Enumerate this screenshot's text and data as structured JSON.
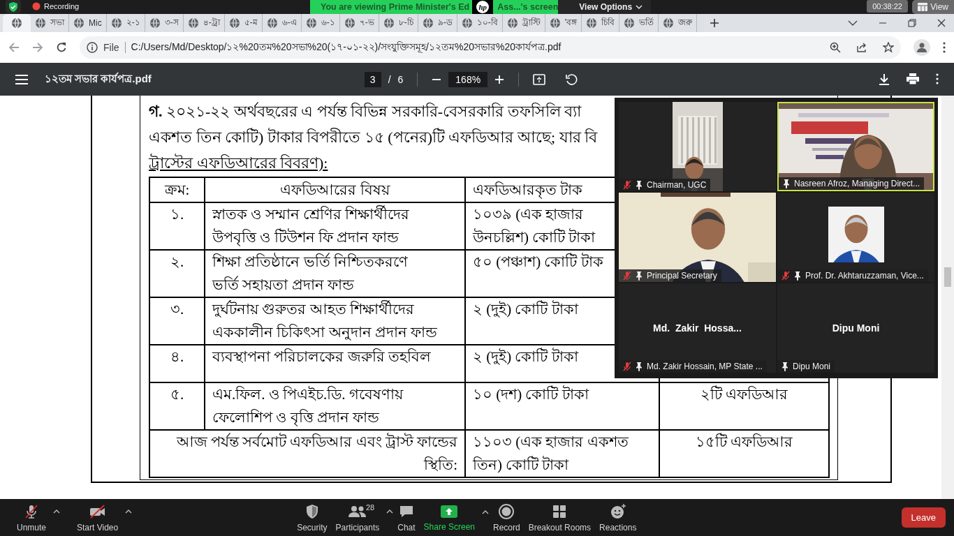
{
  "share_bar": {
    "recording": "Recording",
    "banner_start": "You are viewing Prime Minister's Ed",
    "logo": "hp",
    "banner_end": "Ass...'s screen",
    "view_options": "View Options",
    "timer": "00:38:22",
    "view": "View"
  },
  "browser": {
    "tabs": [
      {
        "selected": true
      },
      {
        "title": "সভা",
        "selected": false
      },
      {
        "title": "Mic",
        "selected": false
      },
      {
        "title": "২-১",
        "selected": false
      },
      {
        "title": "৩-স",
        "selected": false
      },
      {
        "title": "৪-ট্রা",
        "selected": false
      },
      {
        "title": "৫-ম",
        "selected": false
      },
      {
        "title": "৬-এ",
        "selected": false
      },
      {
        "title": "৬-১",
        "selected": false
      },
      {
        "title": "৭-ভ",
        "selected": false
      },
      {
        "title": "৮-চি",
        "selected": false
      },
      {
        "title": "৯-ড",
        "selected": false
      },
      {
        "title": "১০-বি",
        "selected": false
      },
      {
        "title": "ট্রাস্টি",
        "selected": false
      },
      {
        "title": "'বঙ্গ",
        "selected": false
      },
      {
        "title": "চিবি",
        "selected": false
      },
      {
        "title": "ভর্তি",
        "selected": false
      },
      {
        "title": "জরু",
        "selected": false
      }
    ],
    "address": {
      "scheme": "File",
      "url": "C:/Users/Md/Desktop/১২%20তম%20সভা%20(১৭-০১-২২)/সংযুক্তিসমূহ/১২তম%20সভার%20কার্যপত্র.pdf"
    }
  },
  "pdf_toolbar": {
    "title": "১২তম সভার কার্যপত্র.pdf",
    "page": "3",
    "page_separator": "/",
    "pages": "6",
    "zoom": "168%"
  },
  "document": {
    "paragraph": [
      "**গ.** ২০২১-২২ অর্থবছরের এ পর্যন্ত বিভিন্ন সরকারি-বেসরকারি তফসিলি ব্যা",
      "একশত তিন কোটি) টাকার বিপরীতে ১৫ (পনের)টি এফডিআর আছে; যার বি",
      "ট্রাস্টের এফডিআরের বিবরণ):"
    ],
    "table": {
      "columns": [
        "ক্রম:",
        "এফডিআরের বিষয়",
        "এফডিআরকৃত টাক"
      ],
      "rows": [
        {
          "kind": "item",
          "number": "১.",
          "subject": [
            "স্নাতক ও সম্মান শ্রেণির শিক্ষার্থীদের",
            "উপবৃত্তি ও টিউশন ফি প্রদান ফান্ড"
          ],
          "amount": [
            "১০৩৯ (এক হাজার",
            "উনচল্লিশ) কোটি টাকা"
          ]
        },
        {
          "kind": "item",
          "number": "২.",
          "subject": [
            "শিক্ষা প্রতিষ্ঠানে ভর্তি নিশ্চিতকরণে",
            "ভর্তি সহায়তা প্রদান ফান্ড"
          ],
          "amount": [
            "৫০ (পঞ্চাশ) কোটি টাক"
          ]
        },
        {
          "kind": "item",
          "number": "৩.",
          "subject": [
            "দুর্ঘটনায় গুরুতর আহত শিক্ষার্থীদের",
            "এককালীন চিকিৎসা অনুদান প্রদান ফান্ড"
          ],
          "amount": [
            "২ (দুই) কোটি টাকা"
          ]
        },
        {
          "kind": "item",
          "number": "৪.",
          "subject": [
            "ব্যবস্থাপনা পরিচালকের জরুরি তহবিল"
          ],
          "amount": [
            "২ (দুই) কোটি টাকা"
          ]
        },
        {
          "kind": "item",
          "number": "৫.",
          "subject": [
            "এম.ফিল. ও পিএইচ.ডি. গবেষণায়",
            "ফেলোশিপ ও বৃত্তি প্রদান ফান্ড"
          ],
          "amount": [
            "১০ (দশ) কোটি টাকা"
          ],
          "count": "২টি এফডিআর"
        },
        {
          "kind": "total",
          "label": [
            "আজ পর্যন্ত সর্বমোট এফডিআর এবং ট্রাস্ট ফান্ডের",
            "স্থিতি:"
          ],
          "amount": [
            "১১০৩ (এক হাজার একশত",
            "তিন) কোটি টাকা"
          ],
          "count": "১৫টি এফডিআর"
        }
      ]
    }
  },
  "meeting": {
    "tiles": [
      {
        "kind": "small_video",
        "label": "Chairman, UGC",
        "muted": true,
        "speaking": false
      },
      {
        "kind": "video",
        "label": "Nasreen Afroz, Managing Direct...",
        "muted": false,
        "speaking": true
      },
      {
        "kind": "video",
        "label": "Principal Secretary",
        "muted": true,
        "speaking": false
      },
      {
        "label": "Prof. Dr. Akhtaruzzaman, Vice...",
        "muted": true,
        "speaking": false
      },
      {
        "kind": "name",
        "center_name": "Md.  Zakir  Hossa...",
        "label": "Md. Zakir Hossain, MP State ...",
        "muted": true,
        "speaking": false
      },
      {
        "kind": "name",
        "center_name": "Dipu Moni",
        "label": "Dipu Moni",
        "muted": false,
        "speaking": false
      }
    ]
  },
  "toolbar": {
    "items": [
      {
        "label": "Unmute",
        "has_menu": true,
        "accent": false
      },
      {
        "label": "Start Video",
        "has_menu": true,
        "accent": false
      },
      {
        "label": "Security",
        "has_menu": false,
        "accent": false
      },
      {
        "label": "Participants",
        "count": "28",
        "has_menu": true,
        "accent": false
      },
      {
        "label": "Chat",
        "has_menu": false,
        "accent": false
      },
      {
        "label": "Share Screen",
        "has_menu": true,
        "accent": true
      },
      {
        "label": "Record",
        "has_menu": false,
        "accent": false
      },
      {
        "label": "Breakout Rooms",
        "has_menu": false,
        "accent": false
      },
      {
        "label": "Reactions",
        "has_menu": false,
        "accent": false
      }
    ],
    "leave": "Leave"
  }
}
